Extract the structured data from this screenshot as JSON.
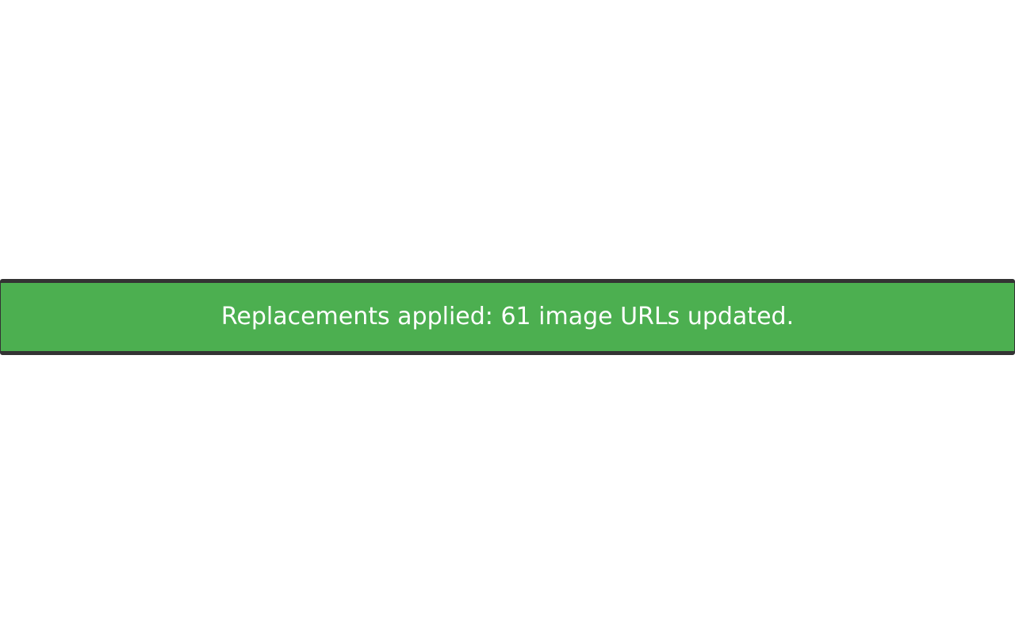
{
  "notification": {
    "message": "Replacements applied: 61 image URLs updated.",
    "background_color": "#4caf50",
    "border_color": "#333333",
    "text_color": "#ffffff",
    "status": "success"
  }
}
